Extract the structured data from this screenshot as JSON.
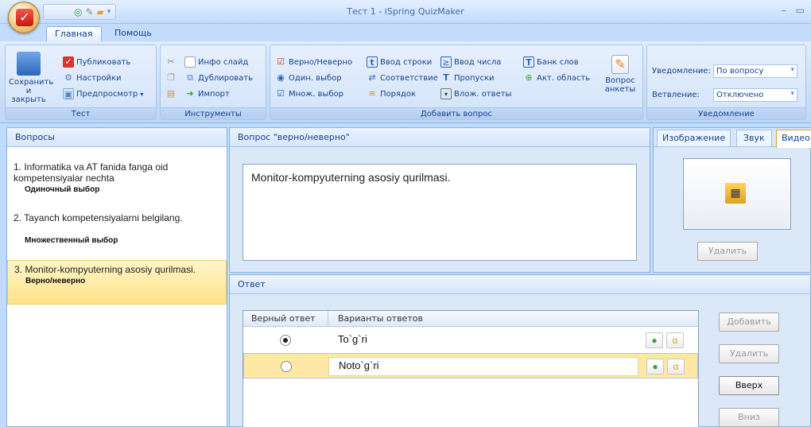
{
  "window": {
    "title": "Тест 1 - iSpring QuizMaker"
  },
  "tabs": [
    {
      "label": "Главная"
    },
    {
      "label": "Помощь"
    }
  ],
  "ribbon": {
    "test_group": {
      "label": "Тест",
      "save": "Сохранить\nи закрыть",
      "publish": "Публиковать",
      "settings": "Настройки",
      "preview": "Предпросмотр"
    },
    "tools_group": {
      "label": "Инструменты",
      "info_slide": "Инфо слайд",
      "duplicate": "Дублировать",
      "import": "Импорт"
    },
    "add_group": {
      "label": "Добавить вопрос",
      "true_false": "Верно/Неверно",
      "single": "Один. выбор",
      "multiple": "Множ. выбор",
      "short_answer": "Ввод строки",
      "matching": "Соответствие",
      "sequence": "Порядок",
      "numeric": "Ввод числа",
      "fill_blanks": "Пропуски",
      "dropdowns": "Влож. ответы",
      "word_bank": "Банк слов",
      "hotspot": "Акт. область",
      "survey": "Вопрос\nанкеты"
    },
    "notify_group": {
      "label": "Уведомление",
      "feedback_label": "Уведомление:",
      "feedback_value": "По вопросу",
      "branching_label": "Ветвление:",
      "branching_value": "Отключено"
    }
  },
  "questions_panel": {
    "title": "Вопросы",
    "items": [
      {
        "text": "1. Informatika va AT fanida fanga oid kompetensiyalar nechta",
        "type": "Одиночный выбор"
      },
      {
        "text": "2. Tayanch kompetensiyalarni belgilang.",
        "type": "Множественный выбор"
      },
      {
        "text": "3. Monitor-kompyuterning asosiy qurilmasi.",
        "type": "Верно/неверно"
      }
    ]
  },
  "question_editor": {
    "title": "Вопрос \"верно/неверно\"",
    "text": "Monitor-kompyuterning asosiy qurilmasi."
  },
  "media": {
    "tabs": [
      "Изображение",
      "Звук",
      "Видео"
    ],
    "delete": "Удалить"
  },
  "answers": {
    "title": "Ответ",
    "col_correct": "Верный ответ",
    "col_options": "Варианты ответов",
    "rows": [
      {
        "text": "To`g`ri",
        "correct": true
      },
      {
        "text": "Noto`g`ri",
        "correct": false
      }
    ],
    "buttons": {
      "add": "Добавить",
      "delete": "Удалить",
      "up": "Вверх",
      "down": "Вниз"
    }
  },
  "colors": {
    "accent": "#15428b",
    "selection": "#ffe38a"
  }
}
